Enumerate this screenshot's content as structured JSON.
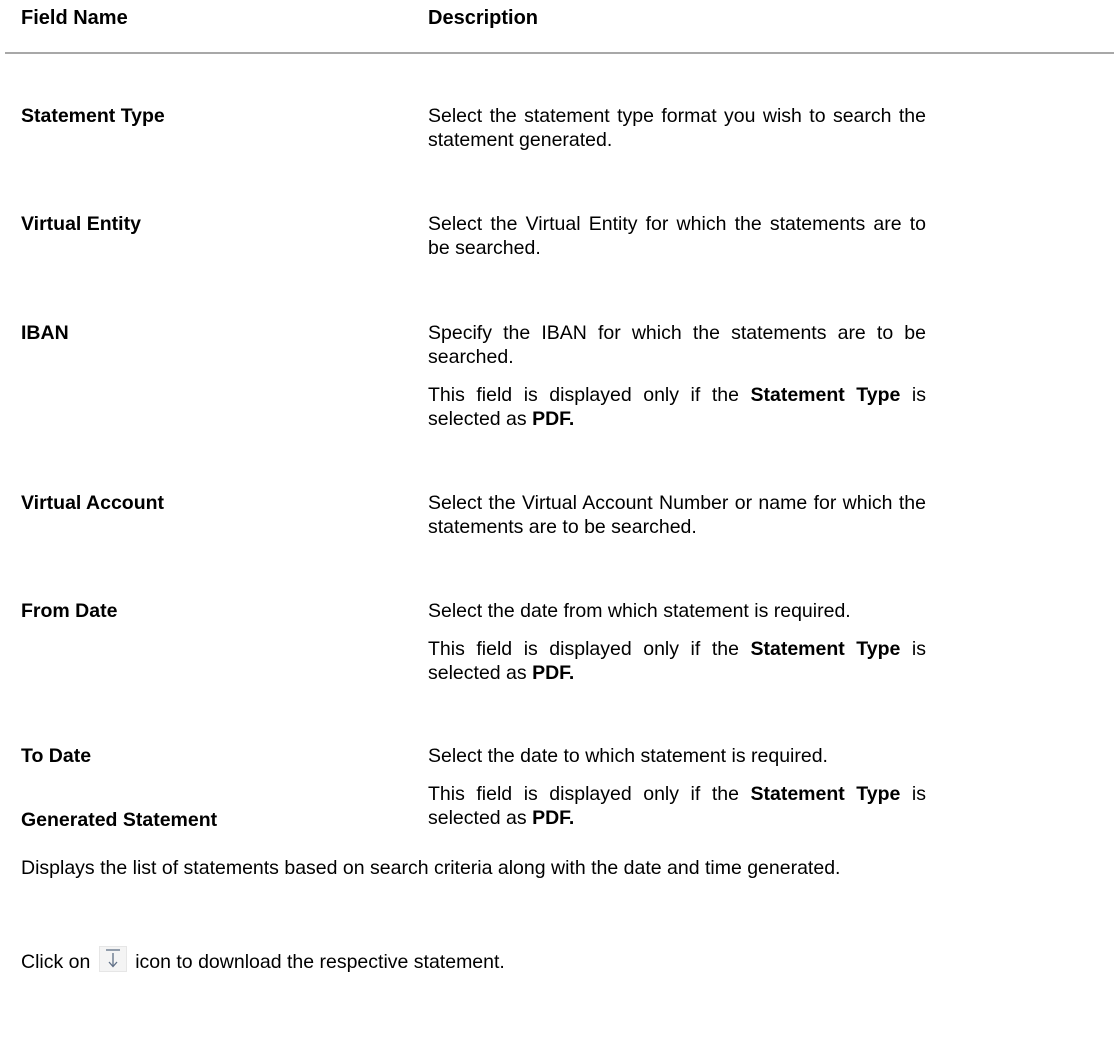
{
  "header": {
    "field_name": "Field Name",
    "description": "Description"
  },
  "rows": [
    {
      "name": "Statement Type",
      "desc1": "Select the statement type format you wish to search the statement generated."
    },
    {
      "name": "Virtual Entity",
      "desc1": "Select the Virtual Entity for which the statements are to be searched."
    },
    {
      "name": "IBAN",
      "desc1": "Specify the IBAN for which the statements are to be searched.",
      "note_pre": "This field is displayed only if the ",
      "note_bold1": "Statement Type",
      "note_mid": " is selected as ",
      "note_bold2": "PDF."
    },
    {
      "name": "Virtual Account",
      "desc1": "Select the Virtual Account Number or name for which the statements are to be searched."
    },
    {
      "name": "From Date",
      "desc1": "Select the date from which statement is required.",
      "note_pre": "This field is displayed only if the ",
      "note_bold1": "Statement Type",
      "note_mid": " is selected as ",
      "note_bold2": "PDF."
    },
    {
      "name": "To Date",
      "desc1": "Select the date to which statement is required.",
      "note_pre": "This field is displayed only if the ",
      "note_bold1": "Statement Type",
      "note_mid": " is selected as ",
      "note_bold2": "PDF."
    }
  ],
  "generated": {
    "title": "Generated Statement",
    "desc": "Displays the list of statements based on search criteria along with the date and time generated.",
    "click_pre": "Click on",
    "click_post": "icon to download the respective statement.",
    "icon": "download-icon"
  }
}
